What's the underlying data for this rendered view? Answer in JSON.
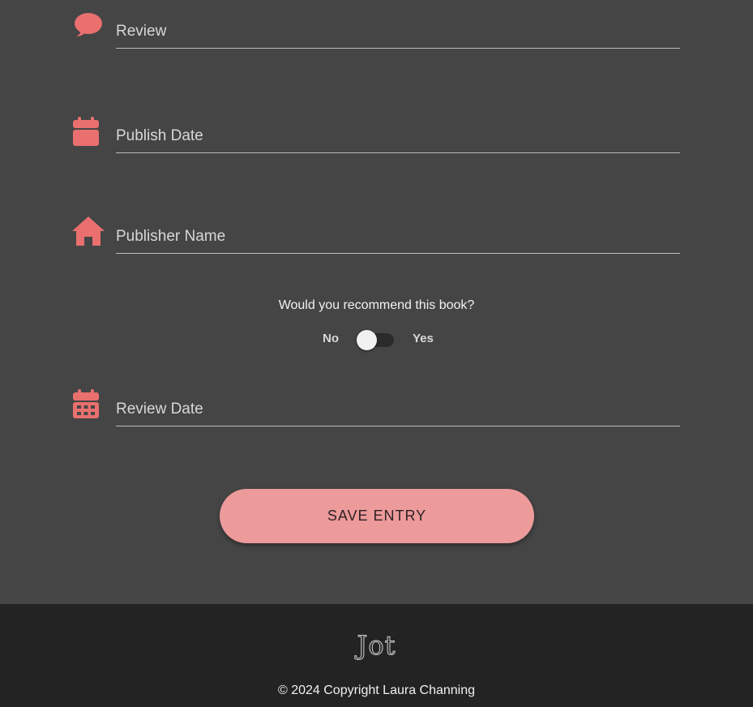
{
  "form": {
    "fields": [
      {
        "id": "review",
        "placeholder": "Review",
        "icon": "speech-bubble-icon"
      },
      {
        "id": "publish_date",
        "placeholder": "Publish Date",
        "icon": "calendar-icon"
      },
      {
        "id": "publisher_name",
        "placeholder": "Publisher Name",
        "icon": "house-icon"
      },
      {
        "id": "review_date",
        "placeholder": "Review Date",
        "icon": "calendar-days-icon"
      }
    ],
    "recommend": {
      "question": "Would you recommend this book?",
      "no_label": "No",
      "yes_label": "Yes",
      "value": false
    },
    "save_label": "SAVE ENTRY"
  },
  "footer": {
    "logo": "Jot",
    "copyright": "© 2024 Copyright Laura Channing"
  },
  "colors": {
    "accent": "#e9706f",
    "button": "#ed9a9b",
    "background": "#454545",
    "footer": "#232323"
  }
}
